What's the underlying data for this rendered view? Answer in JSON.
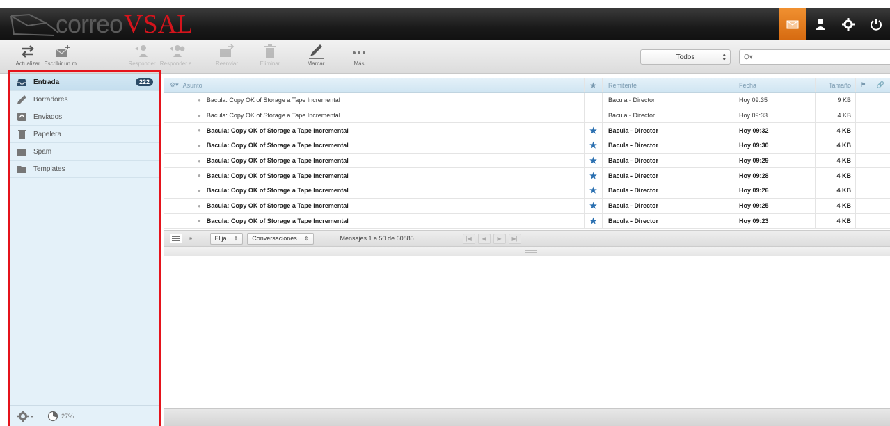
{
  "brand": {
    "part1": "correo",
    "part2": "VSAL"
  },
  "header_icons": [
    "mail-icon",
    "user-icon",
    "gear-icon",
    "power-icon"
  ],
  "toolbar": {
    "refresh": "Actualizar",
    "compose": "Escribir un m...",
    "reply": "Responder",
    "reply_all": "Responder a...",
    "forward": "Reenviar",
    "delete": "Eliminar",
    "mark": "Marcar",
    "more": "Más",
    "filter_value": "Todos",
    "search_placeholder": "Q▾"
  },
  "sidebar": {
    "folders": [
      {
        "label": "Entrada",
        "badge": "222",
        "icon": "inbox-icon"
      },
      {
        "label": "Borradores",
        "icon": "pencil-icon"
      },
      {
        "label": "Enviados",
        "icon": "sent-icon"
      },
      {
        "label": "Papelera",
        "icon": "trash-icon"
      },
      {
        "label": "Spam",
        "icon": "folder-icon"
      },
      {
        "label": "Templates",
        "icon": "folder-icon"
      }
    ],
    "quota": "27%"
  },
  "columns": {
    "subject": "Asunto",
    "from": "Remitente",
    "date": "Fecha",
    "size": "Tamaño"
  },
  "messages": [
    {
      "subject": "Bacula: Copy OK of Storage a Tape Incremental",
      "from": "Bacula - Director",
      "date": "Hoy 09:35",
      "size": "9 KB",
      "unread": false
    },
    {
      "subject": "Bacula: Copy OK of Storage a Tape Incremental",
      "from": "Bacula - Director",
      "date": "Hoy 09:33",
      "size": "4 KB",
      "unread": false
    },
    {
      "subject": "Bacula: Copy OK of Storage a Tape Incremental",
      "from": "Bacula - Director",
      "date": "Hoy 09:32",
      "size": "4 KB",
      "unread": true
    },
    {
      "subject": "Bacula: Copy OK of Storage a Tape Incremental",
      "from": "Bacula - Director",
      "date": "Hoy 09:30",
      "size": "4 KB",
      "unread": true
    },
    {
      "subject": "Bacula: Copy OK of Storage a Tape Incremental",
      "from": "Bacula - Director",
      "date": "Hoy 09:29",
      "size": "4 KB",
      "unread": true
    },
    {
      "subject": "Bacula: Copy OK of Storage a Tape Incremental",
      "from": "Bacula - Director",
      "date": "Hoy 09:28",
      "size": "4 KB",
      "unread": true
    },
    {
      "subject": "Bacula: Copy OK of Storage a Tape Incremental",
      "from": "Bacula - Director",
      "date": "Hoy 09:26",
      "size": "4 KB",
      "unread": true
    },
    {
      "subject": "Bacula: Copy OK of Storage a Tape Incremental",
      "from": "Bacula - Director",
      "date": "Hoy 09:25",
      "size": "4 KB",
      "unread": true
    },
    {
      "subject": "Bacula: Copy OK of Storage a Tape Incremental",
      "from": "Bacula - Director",
      "date": "Hoy 09:23",
      "size": "4 KB",
      "unread": true
    }
  ],
  "list_footer": {
    "select_label": "Elija",
    "threads_label": "Conversaciones",
    "count_text": "Mensajes 1 a 50 de 60885"
  },
  "colors": {
    "accent": "#e07a1e",
    "highlight_frame": "#e5131b",
    "sidebar_bg": "#e4f1f9",
    "star": "#2a6fb0"
  }
}
